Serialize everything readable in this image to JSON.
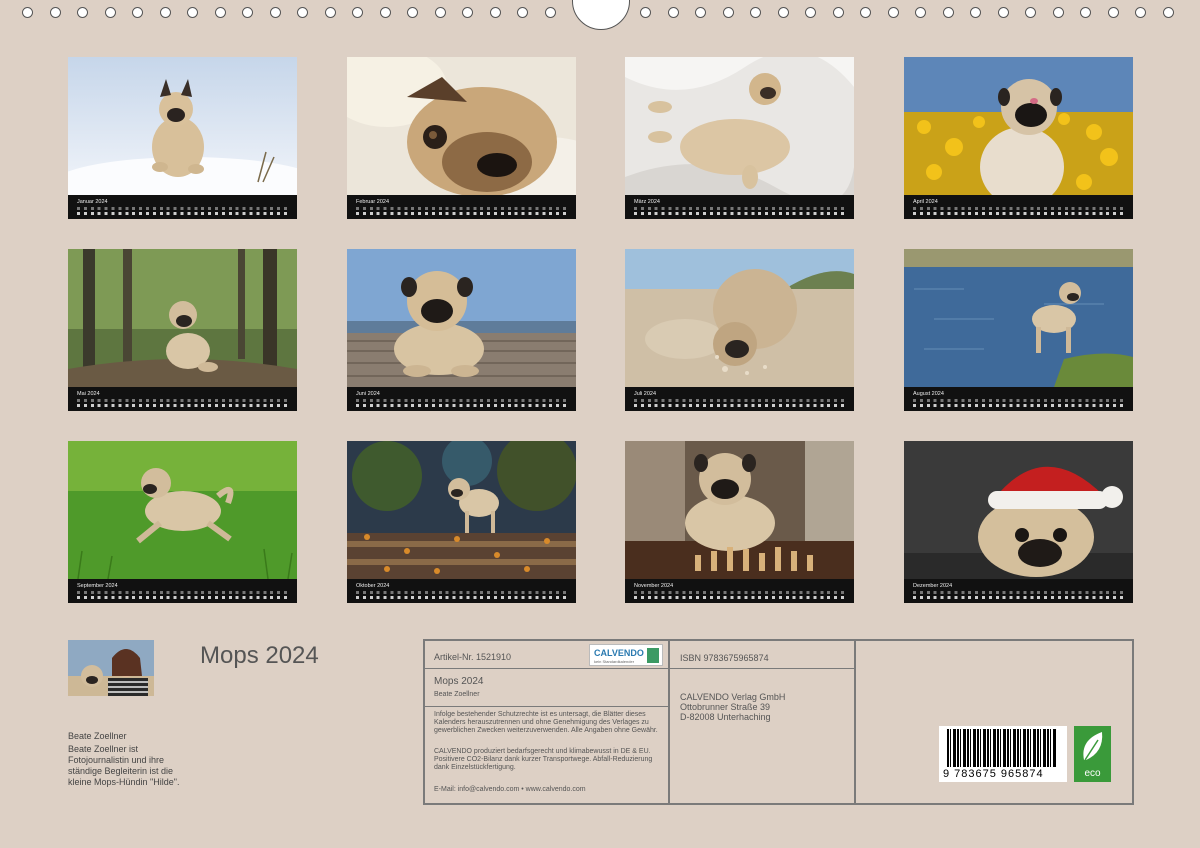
{
  "calendar": {
    "title": "Mops 2024",
    "months": [
      {
        "name": "Januar 2024",
        "photo": "pug-running-in-snow"
      },
      {
        "name": "Februar 2024",
        "photo": "pug-face-in-blanket"
      },
      {
        "name": "März 2024",
        "photo": "pug-sleeping-on-back"
      },
      {
        "name": "April 2024",
        "photo": "pug-in-dandelion-field"
      },
      {
        "name": "Mai 2024",
        "photo": "pug-sitting-in-forest"
      },
      {
        "name": "Juni 2024",
        "photo": "pug-lying-on-boardwalk"
      },
      {
        "name": "Juli 2024",
        "photo": "pug-digging-in-sand"
      },
      {
        "name": "August 2024",
        "photo": "pug-standing-in-water"
      },
      {
        "name": "September 2024",
        "photo": "pug-running-on-grass"
      },
      {
        "name": "Oktober 2024",
        "photo": "pug-on-autumn-steps"
      },
      {
        "name": "November 2024",
        "photo": "pug-with-chess-pieces"
      },
      {
        "name": "Dezember 2024",
        "photo": "pug-with-santa-hat"
      }
    ]
  },
  "author": {
    "name": "Beate Zoellner",
    "bio": "Beate Zoellner ist Fotojournalistin und ihre ständige Begleiterin ist die kleine Mops-Hündin \"Hilde\"."
  },
  "info": {
    "article": "Artikel-Nr. 1521910",
    "logo_name": "CALVENDO",
    "logo_sub": "kein Standardkalender",
    "title": "Mops 2024",
    "author": "Beate Zoellner",
    "legal": "Infolge bestehender Schutzrechte ist es untersagt, die Blätter dieses Kalenders herauszutrennen und ohne Genehmigung des Verlages zu gewerblichen Zwecken weiterzuverwenden. Alle Angaben ohne Gewähr.",
    "eco_note": "CALVENDO produziert bedarfsgerecht und klimabewusst in DE & EU. Positivere CO2-Bilanz dank kurzer Transportwege. Abfall-Reduzierung dank Einzelstückfertigung.",
    "contact": "E-Mail: info@calvendo.com • www.calvendo.com",
    "isbn": "ISBN 9783675965874",
    "publisher_name": "CALVENDO Verlag GmbH",
    "publisher_street": "Ottobrunner Straße 39",
    "publisher_city": "D-82008 Unterhaching",
    "barcode_number": "9 783675 965874",
    "eco_label": "eco"
  }
}
